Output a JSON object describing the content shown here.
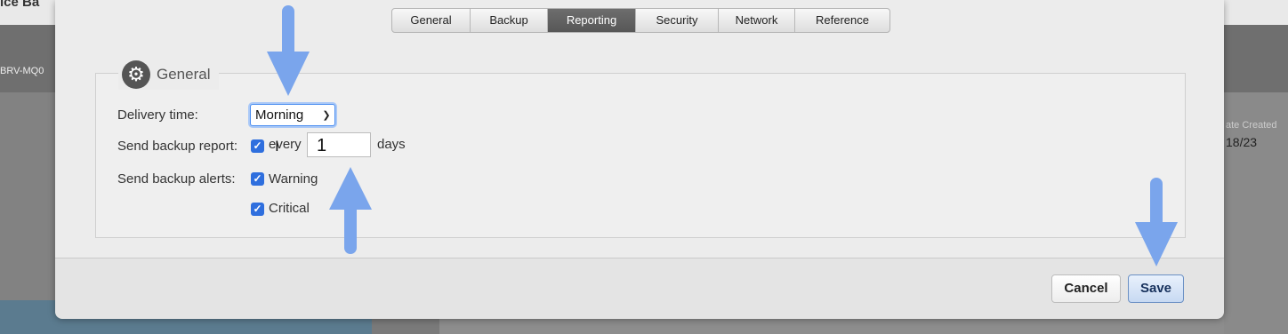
{
  "background": {
    "app_title": "ice Ba",
    "device_name": "BRV-MQ0",
    "date_created_header": "ate Created",
    "date_created_value": "18/23"
  },
  "tabs": [
    {
      "label": "General",
      "active": false
    },
    {
      "label": "Backup",
      "active": false
    },
    {
      "label": "Reporting",
      "active": true
    },
    {
      "label": "Security",
      "active": false
    },
    {
      "label": "Network",
      "active": false
    },
    {
      "label": "Reference",
      "active": false
    }
  ],
  "section": {
    "title": "General",
    "icon": "gear-icon"
  },
  "form": {
    "delivery_time_label": "Delivery time:",
    "delivery_time_value": "Morning",
    "send_report_label": "Send backup report:",
    "send_report_checked": true,
    "every_label": "every",
    "every_value": "1",
    "days_label": "days",
    "send_alerts_label": "Send backup alerts:",
    "warning_label": "Warning",
    "warning_checked": true,
    "critical_label": "Critical",
    "critical_checked": true
  },
  "footer": {
    "cancel_label": "Cancel",
    "save_label": "Save"
  },
  "colors": {
    "accent": "#2f6fde",
    "annotation_arrow": "#7aa5ec",
    "active_tab": "#5f5f5f"
  }
}
